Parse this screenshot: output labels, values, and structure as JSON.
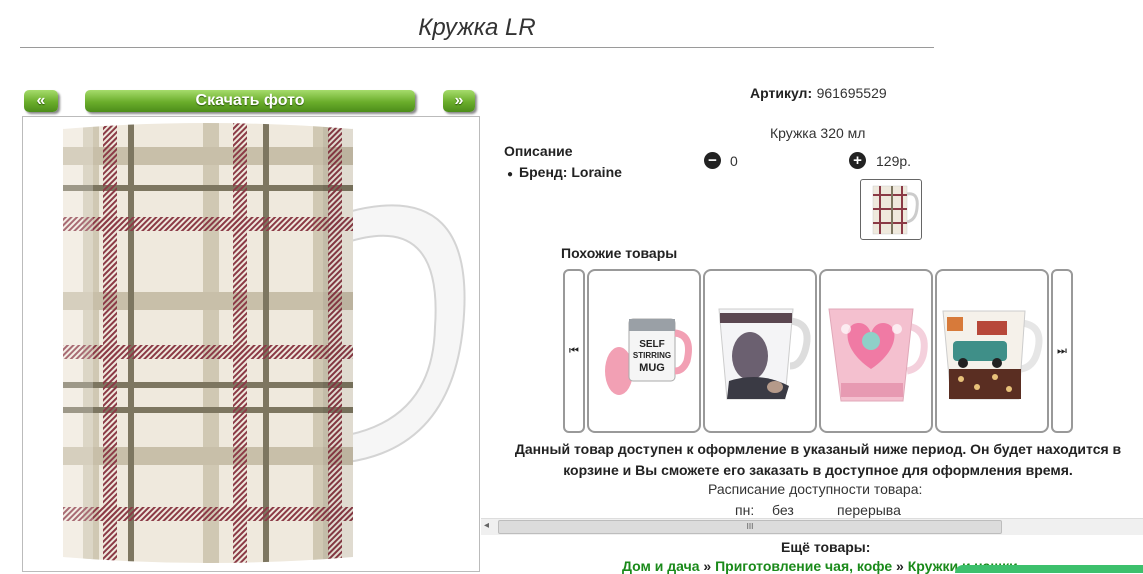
{
  "page_title": "Кружка LR",
  "nav": {
    "prev": "«",
    "download": "Скачать фото",
    "next": "»"
  },
  "info": {
    "article_label": "Артикул:",
    "article_value": "961695529",
    "product_name": "Кружка 320 мл",
    "description_label": "Описание",
    "brand_label": "Бренд: Loraine",
    "qty_minus": "−",
    "qty_value": "0",
    "qty_plus": "+",
    "price": "129р."
  },
  "similar": {
    "title": "Похожие товары",
    "prev_icon": "⏮",
    "next_icon": "⏭",
    "items": [
      {
        "name": "self-stirring-mug",
        "print": "SELF STIRRING MUG"
      },
      {
        "name": "grey-print-mug",
        "print": ""
      },
      {
        "name": "pink-heart-mug",
        "print": ""
      },
      {
        "name": "car-print-mug",
        "print": ""
      }
    ]
  },
  "notice": "Данный товар доступен к оформление в указаный ниже период. Он будет находится в корзине и Вы сможете его заказать в доступное для оформления время.",
  "schedule": {
    "title": "Расписание доступности товара:",
    "day": "пн:",
    "without": "без",
    "breaks": "перерыва"
  },
  "scroll": {
    "left_arrow": "◂",
    "grip": "III"
  },
  "more": {
    "title": "Ещё товары:",
    "crumbs": [
      "Дом и дача",
      "Приготовление чая, кофе",
      "Кружки и чашки"
    ],
    "separator": "»"
  },
  "colors": {
    "accent_green": "#6aad2b",
    "link_green": "#1a8a1a",
    "plaid_red": "#8b3a46",
    "plaid_beige": "#a89c86"
  }
}
